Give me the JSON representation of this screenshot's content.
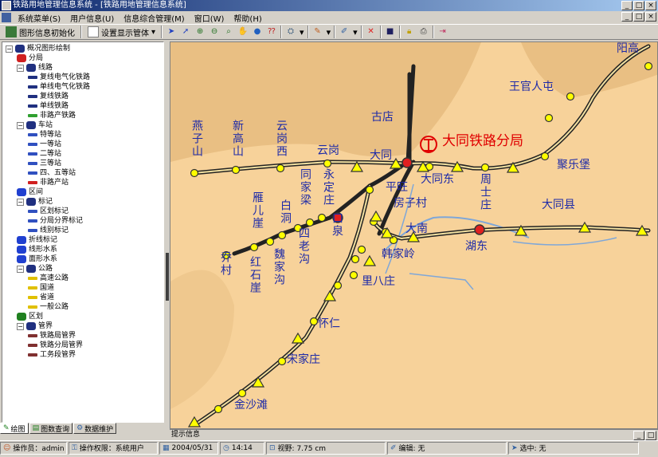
{
  "window": {
    "title": "铁路用地管理信息系统 - [铁路用地管理信息系统]",
    "min": "_",
    "max": "□",
    "close": "×"
  },
  "menu": {
    "items": [
      "系统菜单(S)",
      "用户信息(U)",
      "信息综合管理(M)",
      "窗口(W)",
      "帮助(H)"
    ]
  },
  "toolbar": {
    "init_label": "图形信息初始化",
    "display_label": "设置显示管体"
  },
  "tree": [
    {
      "text": "概况图形绘制",
      "level": 0,
      "icon": "map-root-icon",
      "expander": "−",
      "color": "#203080"
    },
    {
      "text": "分局",
      "level": 1,
      "icon": "bureau-icon",
      "color": "#d02020"
    },
    {
      "text": "线路",
      "level": 1,
      "icon": "line-icon",
      "expander": "−",
      "color": "#203080"
    },
    {
      "text": "复线电气化铁路",
      "level": 2,
      "icon": "double-electric-rail-icon",
      "color": "#203080"
    },
    {
      "text": "单线电气化铁路",
      "level": 2,
      "icon": "single-electric-rail-icon",
      "color": "#203080"
    },
    {
      "text": "复线铁路",
      "level": 2,
      "icon": "double-rail-icon",
      "color": "#203080"
    },
    {
      "text": "单线铁路",
      "level": 2,
      "icon": "single-rail-icon",
      "color": "#203080"
    },
    {
      "text": "非路产铁路",
      "level": 2,
      "icon": "non-railway-icon",
      "color": "#30a030"
    },
    {
      "text": "车站",
      "level": 1,
      "icon": "station-icon",
      "expander": "−",
      "color": "#203080"
    },
    {
      "text": "特等站",
      "level": 2,
      "icon": "special-station-icon",
      "color": "#3050c0"
    },
    {
      "text": "一等站",
      "level": 2,
      "icon": "first-station-icon",
      "color": "#3050c0"
    },
    {
      "text": "二等站",
      "level": 2,
      "icon": "second-station-icon",
      "color": "#3050c0"
    },
    {
      "text": "三等站",
      "level": 2,
      "icon": "third-station-icon",
      "color": "#3050c0"
    },
    {
      "text": "四、五等站",
      "level": 2,
      "icon": "fourth-station-icon",
      "color": "#3050c0"
    },
    {
      "text": "非路产站",
      "level": 2,
      "icon": "non-railway-station-icon",
      "color": "#d02020"
    },
    {
      "text": "区间",
      "level": 1,
      "icon": "section-icon",
      "color": "#2040d0"
    },
    {
      "text": "标记",
      "level": 1,
      "icon": "mark-icon",
      "expander": "−",
      "color": "#203080"
    },
    {
      "text": "区划标记",
      "level": 2,
      "icon": "region-mark-icon",
      "color": "#3050c0"
    },
    {
      "text": "分局分界标记",
      "level": 2,
      "icon": "bureau-border-mark-icon",
      "color": "#3050c0"
    },
    {
      "text": "线别标记",
      "level": 2,
      "icon": "line-mark-icon",
      "color": "#3050c0"
    },
    {
      "text": "折线标记",
      "level": 1,
      "icon": "polyline-mark-icon",
      "color": "#2040d0"
    },
    {
      "text": "线形水系",
      "level": 1,
      "icon": "line-water-icon",
      "color": "#2040d0"
    },
    {
      "text": "面形水系",
      "level": 1,
      "icon": "area-water-icon",
      "color": "#2040d0"
    },
    {
      "text": "公路",
      "level": 1,
      "icon": "road-icon",
      "expander": "−",
      "color": "#203080"
    },
    {
      "text": "高速公路",
      "level": 2,
      "icon": "expressway-icon",
      "color": "#e0c000"
    },
    {
      "text": "国道",
      "level": 2,
      "icon": "national-road-icon",
      "color": "#e0c000"
    },
    {
      "text": "省道",
      "level": 2,
      "icon": "provincial-road-icon",
      "color": "#e0c000"
    },
    {
      "text": "一般公路",
      "level": 2,
      "icon": "ordinary-road-icon",
      "color": "#e0c000"
    },
    {
      "text": "区划",
      "level": 1,
      "icon": "district-icon",
      "color": "#208020"
    },
    {
      "text": "管界",
      "level": 1,
      "icon": "boundary-icon",
      "expander": "−",
      "color": "#203080"
    },
    {
      "text": "铁路局管界",
      "level": 2,
      "icon": "railway-bureau-boundary-icon",
      "color": "#803030"
    },
    {
      "text": "铁路分局管界",
      "level": 2,
      "icon": "sub-bureau-boundary-icon",
      "color": "#803030"
    },
    {
      "text": "工务段管界",
      "level": 2,
      "icon": "works-boundary-icon",
      "color": "#803030"
    }
  ],
  "tabs": [
    {
      "label": "绘图"
    },
    {
      "label": "图数查询"
    },
    {
      "label": "数据维护"
    }
  ],
  "bottom_panel": {
    "label": "提示信息"
  },
  "status": {
    "operator": "操作员：admin",
    "permission": "操作权限：系统用户",
    "date": "2004/05/31",
    "time": "14:14",
    "view": "视野: 7.75 cm",
    "edit": "编辑: 无",
    "selection": "选中: 无"
  },
  "map": {
    "bureau_label": "大同铁路分局",
    "labels": [
      {
        "text": "阳高",
        "vertical": false
      },
      {
        "text": "王官人屯",
        "vertical": false
      },
      {
        "text": "古店",
        "vertical": false
      },
      {
        "text": "燕子山",
        "vertical": true
      },
      {
        "text": "新高山",
        "vertical": true
      },
      {
        "text": "云岗西",
        "vertical": true
      },
      {
        "text": "云岗",
        "vertical": false
      },
      {
        "text": "大同",
        "vertical": false
      },
      {
        "text": "大同东",
        "vertical": false
      },
      {
        "text": "周士庄",
        "vertical": true
      },
      {
        "text": "聚乐堡",
        "vertical": false
      },
      {
        "text": "同家梁",
        "vertical": true
      },
      {
        "text": "永定庄",
        "vertical": true
      },
      {
        "text": "平旺",
        "vertical": false
      },
      {
        "text": "房子村",
        "vertical": false
      },
      {
        "text": "雁儿崖",
        "vertical": true
      },
      {
        "text": "白洞",
        "vertical": true
      },
      {
        "text": "口泉",
        "vertical": true
      },
      {
        "text": "四老沟",
        "vertical": true
      },
      {
        "text": "大南",
        "vertical": false
      },
      {
        "text": "大同县",
        "vertical": false
      },
      {
        "text": "湖东",
        "vertical": false
      },
      {
        "text": "韩家岭",
        "vertical": false
      },
      {
        "text": "乔村",
        "vertical": true
      },
      {
        "text": "红石崖",
        "vertical": true
      },
      {
        "text": "魏家沟",
        "vertical": true
      },
      {
        "text": "里八庄",
        "vertical": false
      },
      {
        "text": "怀仁",
        "vertical": false
      },
      {
        "text": "宋家庄",
        "vertical": false
      },
      {
        "text": "金沙滩",
        "vertical": false
      }
    ]
  }
}
